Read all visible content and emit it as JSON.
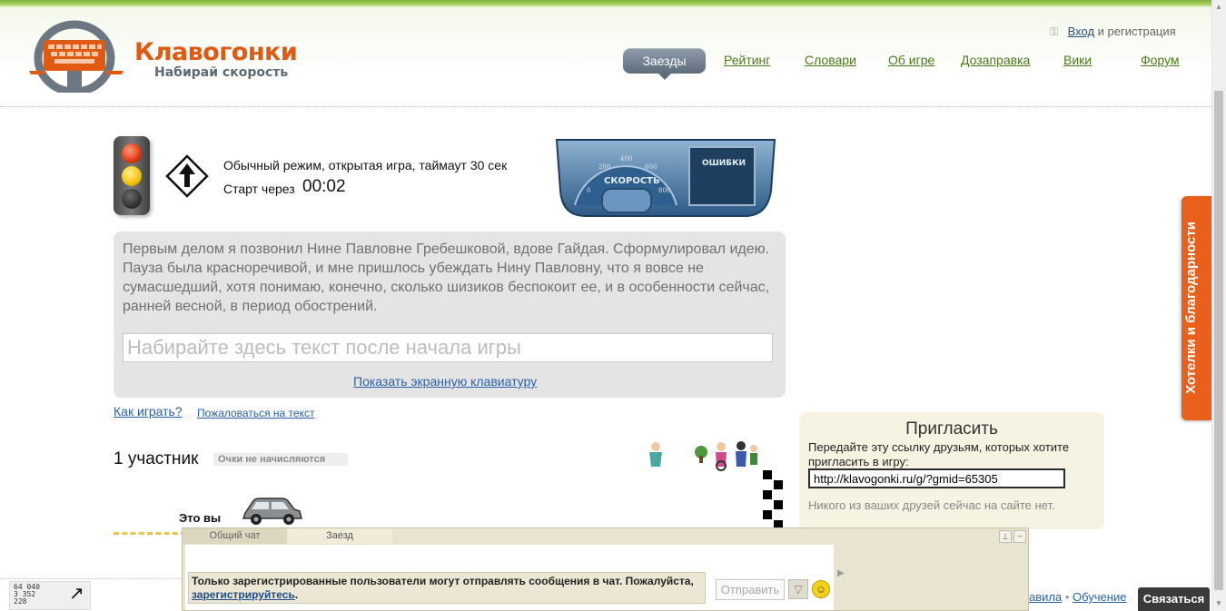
{
  "header": {
    "logo_title": "Клавогонки",
    "logo_subtitle": "Набирай скорость",
    "login_link": "Вход",
    "login_rest": "и регистрация"
  },
  "nav": {
    "active": "Заезды",
    "items": [
      "Рейтинг",
      "Словари",
      "Об игре",
      "Дозаправка",
      "Вики",
      "Форум"
    ]
  },
  "game": {
    "mode": "Обычный режим, открытая игра, таймаут 30 сек",
    "start_label": "Старт через",
    "timer": "00:02",
    "dashboard_speed": "СКОРОСТЬ",
    "dashboard_errors": "ОШИБКИ",
    "speed_ticks": [
      "0",
      "200",
      "400",
      "600",
      "800"
    ],
    "text": "Первым делом я позвонил Нине Павловне Гребешковой, вдове Гайдая. Сформулировал идею. Пауза была красноречивой, и мне пришлось убеждать Нину Павловну, что я вовсе не сумасшедший, хотя понимаю, конечно, сколько шизиков беспокоит ее, и в особенности сейчас, ранней весной, в период обострений.",
    "input_placeholder": "Набирайте здесь текст после начала игры",
    "show_keyboard": "Показать экранную клавиатуру",
    "how_to_play": "Как играть?",
    "complain": "Пожаловаться на текст",
    "participants": "1 участник",
    "no_points": "Очки не начисляются",
    "this_is_you": "Это вы"
  },
  "invite": {
    "title": "Пригласить",
    "description": "Передайте эту ссылку друзьям, которых хотите пригласить в игру:",
    "link": "http://klavogonki.ru/g/?gmid=65305",
    "none_online": "Никого из ваших друзей сейчас на сайте нет."
  },
  "side_tab": "Хотелки и благодарности",
  "chat": {
    "tab_general": "Общий чат",
    "tab_race": "Заезд",
    "notice_text": "Только зарегистрированные пользователи могут отправлять сообщения в чат. Пожалуйста,",
    "notice_link": "зарегистрируйтесь",
    "send_button": "Отправить"
  },
  "footer": {
    "counter_lines": [
      "64 040",
      "3 352",
      "228"
    ],
    "link_rules": "авила",
    "link_training": "Обучение",
    "contact_button": "Связаться"
  },
  "colors": {
    "brand_orange": "#e05a12",
    "nav_green": "#4c7a1a",
    "link_blue": "#2a62a8"
  }
}
